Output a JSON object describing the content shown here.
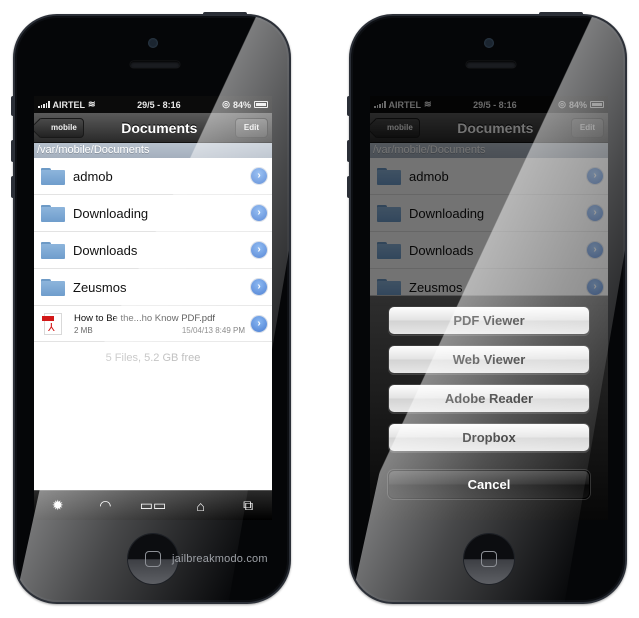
{
  "watermark": "jailbreakmodo.com",
  "status_bar": {
    "carrier": "AIRTEL",
    "time": "29/5 - 8:16",
    "battery": "84%"
  },
  "nav_bar": {
    "back_label": "mobile",
    "title": "Documents",
    "edit_label": "Edit"
  },
  "path": "/var/mobile/Documents",
  "folders": [
    {
      "name": "admob"
    },
    {
      "name": "Downloading"
    },
    {
      "name": "Downloads"
    },
    {
      "name": "Zeusmos"
    }
  ],
  "file": {
    "name": "How to Be the...ho Know PDF.pdf",
    "size": "2 MB",
    "date": "15/04/13 8:49 PM"
  },
  "footer": "5 Files, 5.2 GB free",
  "tab_bar": [
    {
      "icon": "gear-icon",
      "glyph": "✹"
    },
    {
      "icon": "wifi-icon",
      "glyph": "📶"
    },
    {
      "icon": "book-icon",
      "glyph": "🕮"
    },
    {
      "icon": "home-icon",
      "glyph": "⌂"
    },
    {
      "icon": "windows-icon",
      "glyph": "⧉"
    }
  ],
  "action_sheet": {
    "options": [
      "PDF Viewer",
      "Web Viewer",
      "Adobe Reader",
      "Dropbox"
    ],
    "cancel_label": "Cancel"
  },
  "disclosure_glyph": "›"
}
